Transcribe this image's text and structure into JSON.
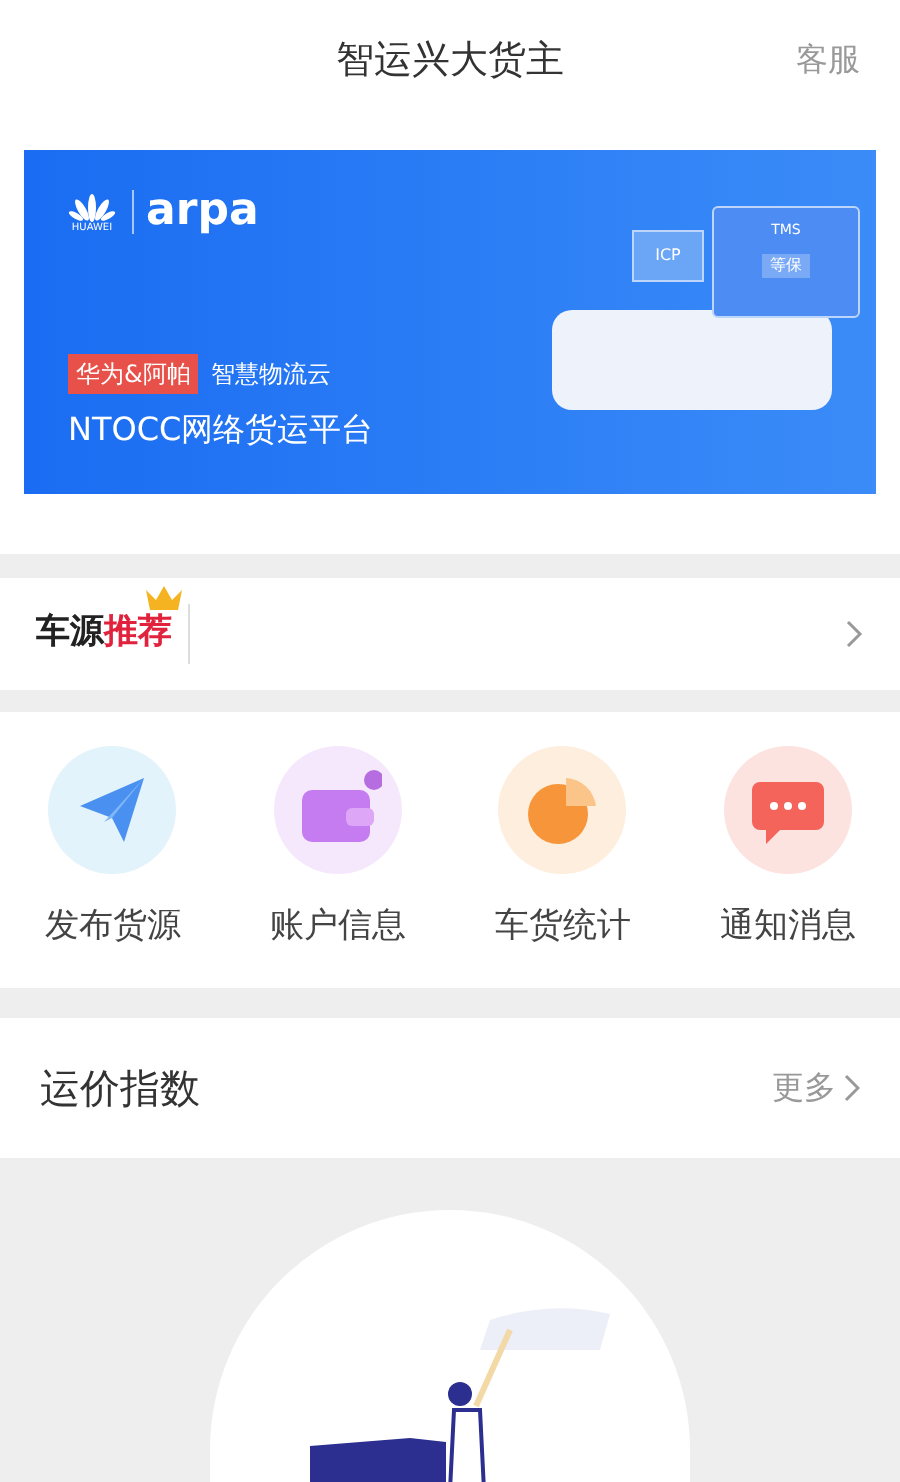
{
  "header": {
    "title": "智运兴大货主",
    "action": "客服"
  },
  "banner": {
    "brand": "arpa",
    "brand_sub": "HUAWEI",
    "tag": "华为&阿帕",
    "tagline": "智慧物流云",
    "headline": "NTOCC网络货运平台",
    "screen_title": "TMS",
    "screen_badge": "等保",
    "card_label": "ICP"
  },
  "recommend": {
    "title": "车源",
    "title_highlight": "推荐"
  },
  "shortcuts": [
    {
      "kind": "send",
      "label": "发布货源",
      "color": "#4a90f0"
    },
    {
      "kind": "wallet",
      "label": "账户信息",
      "color": "#c57cf0"
    },
    {
      "kind": "pie",
      "label": "车货统计",
      "color": "#f7953a"
    },
    {
      "kind": "chat",
      "label": "通知消息",
      "color": "#f5645a"
    }
  ],
  "freight_index": {
    "title": "运价指数",
    "more": "更多"
  }
}
